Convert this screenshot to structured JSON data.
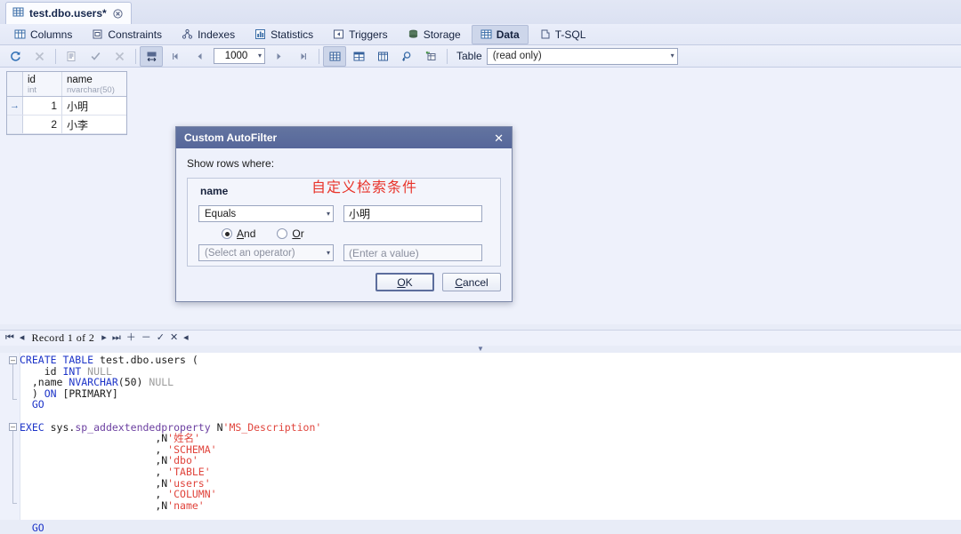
{
  "document_tab": {
    "title": "test.dbo.users*",
    "icon": "table-icon",
    "close": "close-icon"
  },
  "category_tabs": [
    {
      "label": "Columns",
      "icon": "columns-icon",
      "active": false
    },
    {
      "label": "Constraints",
      "icon": "constraints-icon",
      "active": false
    },
    {
      "label": "Indexes",
      "icon": "indexes-icon",
      "active": false
    },
    {
      "label": "Statistics",
      "icon": "statistics-icon",
      "active": false
    },
    {
      "label": "Triggers",
      "icon": "triggers-icon",
      "active": false
    },
    {
      "label": "Storage",
      "icon": "storage-icon",
      "active": false
    },
    {
      "label": "Data",
      "icon": "data-grid-icon",
      "active": true
    },
    {
      "label": "T-SQL",
      "icon": "tsql-icon",
      "active": false
    }
  ],
  "toolbar": {
    "row_limit": "1000",
    "table_label": "Table",
    "table_mode": "(read only)",
    "icons": [
      "refresh-icon",
      "stop-icon",
      "script-icon",
      "commit-icon",
      "rollback-icon",
      "fit-columns-icon",
      "first-page-icon",
      "prev-page-icon",
      "next-page-icon",
      "last-page-icon",
      "grid-view-icon",
      "card-view-icon",
      "form-view-icon",
      "find-icon",
      "filter-icon"
    ]
  },
  "grid": {
    "columns": [
      {
        "name": "id",
        "type": "int"
      },
      {
        "name": "name",
        "type": "nvarchar(50)"
      }
    ],
    "rows": [
      {
        "indicator": "current-row-arrow",
        "id": "1",
        "name": "小明"
      },
      {
        "indicator": "",
        "id": "2",
        "name": "小李"
      }
    ]
  },
  "dialog": {
    "title": "Custom AutoFilter",
    "close": "close-icon",
    "show_rows_where": "Show rows where:",
    "annotation": "自定义检索条件",
    "group_label": "name",
    "condition1": {
      "operator": "Equals",
      "value": "小明"
    },
    "conjunction": {
      "and_label": "And",
      "and_accel": "A",
      "and_selected": true,
      "or_label": "Or",
      "or_accel": "O",
      "or_selected": false
    },
    "condition2": {
      "operator_placeholder": "(Select an operator)",
      "value_placeholder": "(Enter a value)"
    },
    "ok_label": "OK",
    "ok_accel": "O",
    "cancel_label": "Cancel",
    "cancel_accel": "C"
  },
  "record_nav": {
    "text": "Record 1 of 2",
    "buttons": [
      "first-record-icon",
      "prev-record-icon",
      "next-record-icon",
      "last-record-icon",
      "add-record-icon",
      "delete-record-icon",
      "commit-record-icon",
      "cancel-record-icon"
    ],
    "splitter": "chevron-down-icon"
  },
  "sql": {
    "lines": [
      {
        "fold": "open",
        "parts": [
          {
            "t": "CREATE TABLE ",
            "c": "kw"
          },
          {
            "t": "test.dbo.users (",
            "c": ""
          }
        ]
      },
      {
        "fold": "",
        "parts": [
          {
            "t": "    id ",
            "c": ""
          },
          {
            "t": "INT ",
            "c": "kw"
          },
          {
            "t": "NULL",
            "c": "dim"
          }
        ]
      },
      {
        "fold": "",
        "parts": [
          {
            "t": "  ,name ",
            "c": ""
          },
          {
            "t": "NVARCHAR",
            "c": "kw"
          },
          {
            "t": "(50) ",
            "c": ""
          },
          {
            "t": "NULL",
            "c": "dim"
          }
        ]
      },
      {
        "fold": "close",
        "parts": [
          {
            "t": "  ) ",
            "c": ""
          },
          {
            "t": "ON ",
            "c": "kw"
          },
          {
            "t": "[PRIMARY]",
            "c": ""
          }
        ]
      },
      {
        "fold": "",
        "parts": [
          {
            "t": "  GO",
            "c": "kw"
          }
        ]
      },
      {
        "fold": "",
        "parts": [
          {
            "t": "",
            "c": ""
          }
        ]
      },
      {
        "fold": "open",
        "parts": [
          {
            "t": "EXEC ",
            "c": "kw"
          },
          {
            "t": "sys.",
            "c": "sysn"
          },
          {
            "t": "sp_addextendedproperty",
            "c": "fn"
          },
          {
            "t": " N",
            "c": ""
          },
          {
            "t": "'MS_Description'",
            "c": "str"
          }
        ]
      },
      {
        "fold": "",
        "parts": [
          {
            "t": "                      ,N",
            "c": ""
          },
          {
            "t": "'姓名'",
            "c": "str"
          }
        ]
      },
      {
        "fold": "",
        "parts": [
          {
            "t": "                      , ",
            "c": ""
          },
          {
            "t": "'SCHEMA'",
            "c": "str"
          }
        ]
      },
      {
        "fold": "",
        "parts": [
          {
            "t": "                      ,N",
            "c": ""
          },
          {
            "t": "'dbo'",
            "c": "str"
          }
        ]
      },
      {
        "fold": "",
        "parts": [
          {
            "t": "                      , ",
            "c": ""
          },
          {
            "t": "'TABLE'",
            "c": "str"
          }
        ]
      },
      {
        "fold": "",
        "parts": [
          {
            "t": "                      ,N",
            "c": ""
          },
          {
            "t": "'users'",
            "c": "str"
          }
        ]
      },
      {
        "fold": "",
        "parts": [
          {
            "t": "                      , ",
            "c": ""
          },
          {
            "t": "'COLUMN'",
            "c": "str"
          }
        ]
      },
      {
        "fold": "close",
        "parts": [
          {
            "t": "                      ,N",
            "c": ""
          },
          {
            "t": "'name'",
            "c": "str"
          }
        ]
      },
      {
        "fold": "",
        "parts": [
          {
            "t": "",
            "c": ""
          }
        ]
      },
      {
        "fold": "",
        "parts": [
          {
            "t": "  GO",
            "c": "kw"
          }
        ]
      }
    ]
  }
}
